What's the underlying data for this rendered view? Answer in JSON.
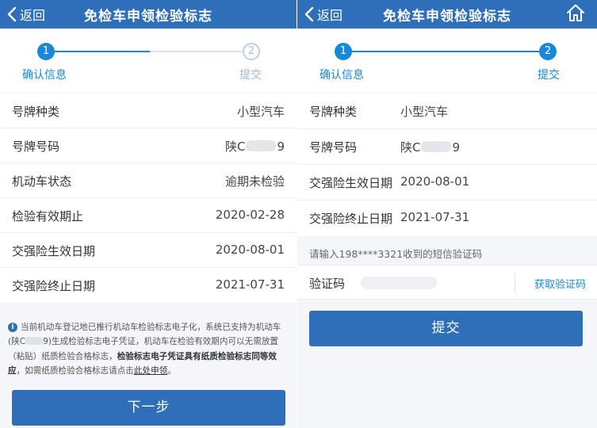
{
  "left": {
    "nav": {
      "back_label": "返回",
      "title": "免检车申领检验标志"
    },
    "steps": [
      {
        "number": "1",
        "label": "确认信息"
      },
      {
        "number": "2",
        "label": "提交"
      }
    ],
    "rows": [
      {
        "label": "号牌种类",
        "value": "小型汽车"
      },
      {
        "label": "号牌号码",
        "value_prefix": "陕C",
        "value_suffix": "9"
      },
      {
        "label": "机动车状态",
        "value": "逾期未检验"
      },
      {
        "label": "检验有效期止",
        "value": "2020-02-28"
      },
      {
        "label": "交强险生效日期",
        "value": "2020-08-01"
      },
      {
        "label": "交强险终止日期",
        "value": "2021-07-31"
      }
    ],
    "notice": {
      "part1": "当前机动车登记地已推行机动车检验标志电子化，系统已支持为机动车(陕C",
      "part2": "9)生成检验标志电子凭证，机动车在检验有效期内可以无需放置（粘贴）纸质检验合格标志，",
      "bold": "检验标志电子凭证具有纸质检验标志同等效应",
      "part3": "，如需纸质检验合格标志请点击",
      "link": "此处申领",
      "end": "。"
    },
    "next_button": "下一步"
  },
  "right": {
    "nav": {
      "back_label": "返回",
      "title": "免检车申领检验标志"
    },
    "home_icon": "home-icon",
    "steps": [
      {
        "number": "1",
        "label": "确认信息"
      },
      {
        "number": "2",
        "label": "提交"
      }
    ],
    "rows": [
      {
        "label": "号牌种类",
        "value": "小型汽车"
      },
      {
        "label": "号牌号码",
        "value_prefix": "陕C",
        "value_suffix": "9"
      },
      {
        "label": "交强险生效日期",
        "value": "2020-08-01"
      },
      {
        "label": "交强险终止日期",
        "value": "2021-07-31"
      }
    ],
    "sms_tip": "请输入198****3321收到的短信验证码",
    "code_label": "验证码",
    "get_code": "获取验证码",
    "submit_button": "提交"
  },
  "colors": {
    "nav_bar": "#2f6fb9",
    "accent": "#1a88d9",
    "inactive_step": "#b9cfe6",
    "button": "#2f6fb9"
  }
}
